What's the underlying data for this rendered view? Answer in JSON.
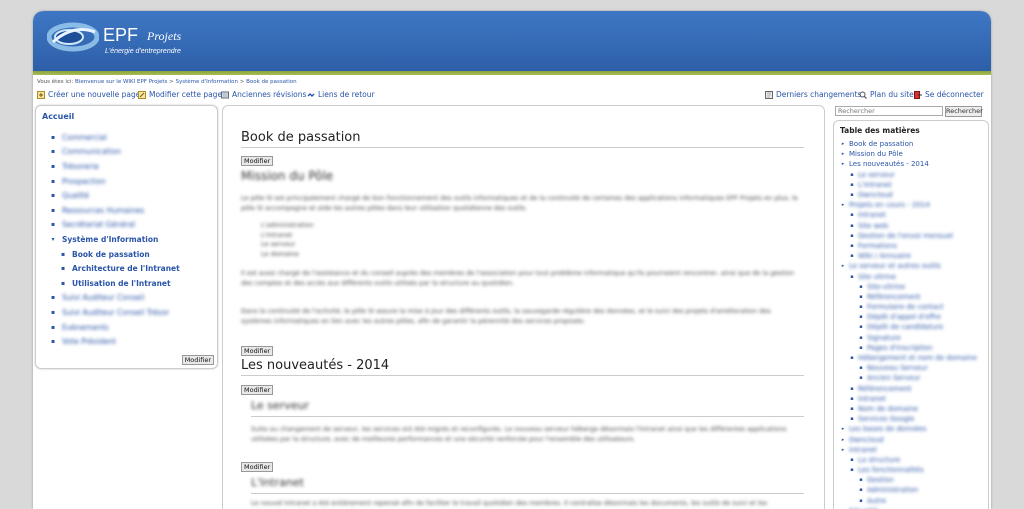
{
  "header": {
    "brand": "EPF",
    "brand_sub": "Projets",
    "tagline": "L'énergie d'entreprendre"
  },
  "breadcrumb": {
    "prefix": "Vous êtes ici:",
    "items": [
      "Bienvenue sur le WIKI EPF Projets",
      "Système d'Information",
      "Book de passation"
    ],
    "separator": ">"
  },
  "actions": {
    "create": "Créer une nouvelle page",
    "edit": "Modifier cette page",
    "revisions": "Anciennes révisions",
    "backlinks": "Liens de retour",
    "recent": "Derniers changements",
    "sitemap": "Plan du site",
    "logout": "Se déconnecter"
  },
  "search": {
    "placeholder": "Rechercher",
    "button": "Rechercher"
  },
  "leftnav": {
    "title": "Accueil",
    "items": [
      {
        "label": "Commercial",
        "blurred": true
      },
      {
        "label": "Communication",
        "blurred": true
      },
      {
        "label": "Trésorerie",
        "blurred": true
      },
      {
        "label": "Prospection",
        "blurred": true
      },
      {
        "label": "Qualité",
        "blurred": true
      },
      {
        "label": "Ressources Humaines",
        "blurred": true
      },
      {
        "label": "Secrétariat Général",
        "blurred": true
      },
      {
        "label": "Système d'Information",
        "blurred": false,
        "open": true
      },
      {
        "label": "Book de passation",
        "blurred": false,
        "sub": true,
        "current": true
      },
      {
        "label": "Architecture de l'Intranet",
        "blurred": false,
        "sub": true
      },
      {
        "label": "Utilisation de l'Intranet",
        "blurred": false,
        "sub": true
      },
      {
        "label": "Suivi Auditeur Conseil",
        "blurred": true
      },
      {
        "label": "Suivi Auditeur Conseil Trésor",
        "blurred": true
      },
      {
        "label": "Evènements",
        "blurred": true
      },
      {
        "label": "Vote Président",
        "blurred": true
      }
    ],
    "modifier": "Modifier"
  },
  "content": {
    "title": "Book de passation",
    "modifier": "Modifier",
    "section1_heading": "Mission du Pôle",
    "section1_para": "Le pôle SI est principalement chargé de bon fonctionnement des outils informatiques et de la continuité de certaines des applications informatiques EPF Projets en plus, le pôle SI accompagne et aide les autres pôles dans leur utilisation quotidienne des outils.",
    "section1_bullets": [
      "L'administration",
      "L'Intranet",
      "Le serveur",
      "Le domaine"
    ],
    "section1_para2": "Il est aussi chargé de l'assistance et du conseil auprès des membres de l'association pour tout problème informatique qu'ils pourraient rencontrer, ainsi que de la gestion des comptes et des accès aux différents outils utilisés par la structure au quotidien.",
    "section1_para3": "Dans la continuité de l'activité, le pôle SI assure la mise à jour des différents outils, la sauvegarde régulière des données, et le suivi des projets d'amélioration des systèmes informatiques en lien avec les autres pôles, afin de garantir la pérennité des services proposés.",
    "section2_title": "Les nouveautés - 2014",
    "section2_sub1": "Le serveur",
    "section2_sub1_para": "Suite au changement de serveur, les services ont été migrés et reconfigurés. Le nouveau serveur héberge désormais l'Intranet ainsi que les différentes applications utilisées par la structure, avec de meilleures performances et une sécurité renforcée pour l'ensemble des utilisateurs.",
    "section2_sub2": "L'Intranet",
    "section2_sub2_para": "Le nouvel Intranet a été entièrement repensé afin de faciliter le travail quotidien des membres. Il centralise désormais les documents, les outils de suivi et les informations utiles à chaque pôle."
  },
  "toc": {
    "title": "Table des matières",
    "items": [
      {
        "label": "Book de passation",
        "level": 0,
        "blurred": false
      },
      {
        "label": "Mission du Pôle",
        "level": 0,
        "blurred": false
      },
      {
        "label": "Les nouveautés - 2014",
        "level": 0,
        "blurred": false
      },
      {
        "label": "Le serveur",
        "level": 1,
        "blurred": true
      },
      {
        "label": "L'Intranet",
        "level": 1,
        "blurred": true
      },
      {
        "label": "Owncloud",
        "level": 1,
        "blurred": true
      },
      {
        "label": "Projets en cours - 2014",
        "level": 0,
        "blurred": true
      },
      {
        "label": "Intranet",
        "level": 1,
        "blurred": true
      },
      {
        "label": "Site web",
        "level": 1,
        "blurred": true
      },
      {
        "label": "Gestion de l'envoi mensuel",
        "level": 1,
        "blurred": true
      },
      {
        "label": "Formations",
        "level": 1,
        "blurred": true
      },
      {
        "label": "Wiki / Annuaire",
        "level": 1,
        "blurred": true
      },
      {
        "label": "Le serveur et autres outils",
        "level": 0,
        "blurred": true
      },
      {
        "label": "Site vitrine",
        "level": 1,
        "blurred": true
      },
      {
        "label": "Site-vitrine",
        "level": 2,
        "blurred": true
      },
      {
        "label": "Référencement",
        "level": 2,
        "blurred": true
      },
      {
        "label": "Formulaire de contact",
        "level": 2,
        "blurred": true
      },
      {
        "label": "Dépôt d'appel d'offre",
        "level": 2,
        "blurred": true
      },
      {
        "label": "Dépôt de candidature",
        "level": 2,
        "blurred": true
      },
      {
        "label": "Signature",
        "level": 2,
        "blurred": true
      },
      {
        "label": "Pages d'inscription",
        "level": 2,
        "blurred": true
      },
      {
        "label": "Hébergement et nom de domaine",
        "level": 1,
        "blurred": true
      },
      {
        "label": "Nouveau Serveur",
        "level": 2,
        "blurred": true
      },
      {
        "label": "Ancien Serveur",
        "level": 2,
        "blurred": true
      },
      {
        "label": "Référencement",
        "level": 1,
        "blurred": true
      },
      {
        "label": "Intranet",
        "level": 1,
        "blurred": true
      },
      {
        "label": "Nom de domaine",
        "level": 1,
        "blurred": true
      },
      {
        "label": "Services Google",
        "level": 1,
        "blurred": true
      },
      {
        "label": "Les bases de données",
        "level": 0,
        "blurred": true
      },
      {
        "label": "Owncloud",
        "level": 0,
        "blurred": true
      },
      {
        "label": "Intranet",
        "level": 0,
        "blurred": true
      },
      {
        "label": "La structure",
        "level": 1,
        "blurred": true
      },
      {
        "label": "Les fonctionnalités",
        "level": 1,
        "blurred": true
      },
      {
        "label": "Gestion",
        "level": 2,
        "blurred": true
      },
      {
        "label": "Administration",
        "level": 2,
        "blurred": true
      },
      {
        "label": "Autre",
        "level": 2,
        "blurred": true
      },
      {
        "label": "Sécurité",
        "level": 0,
        "blurred": true
      }
    ]
  },
  "colors": {
    "header": "#2d5fa8",
    "accent_bar": "#9bb548",
    "link": "#2a55a8"
  }
}
